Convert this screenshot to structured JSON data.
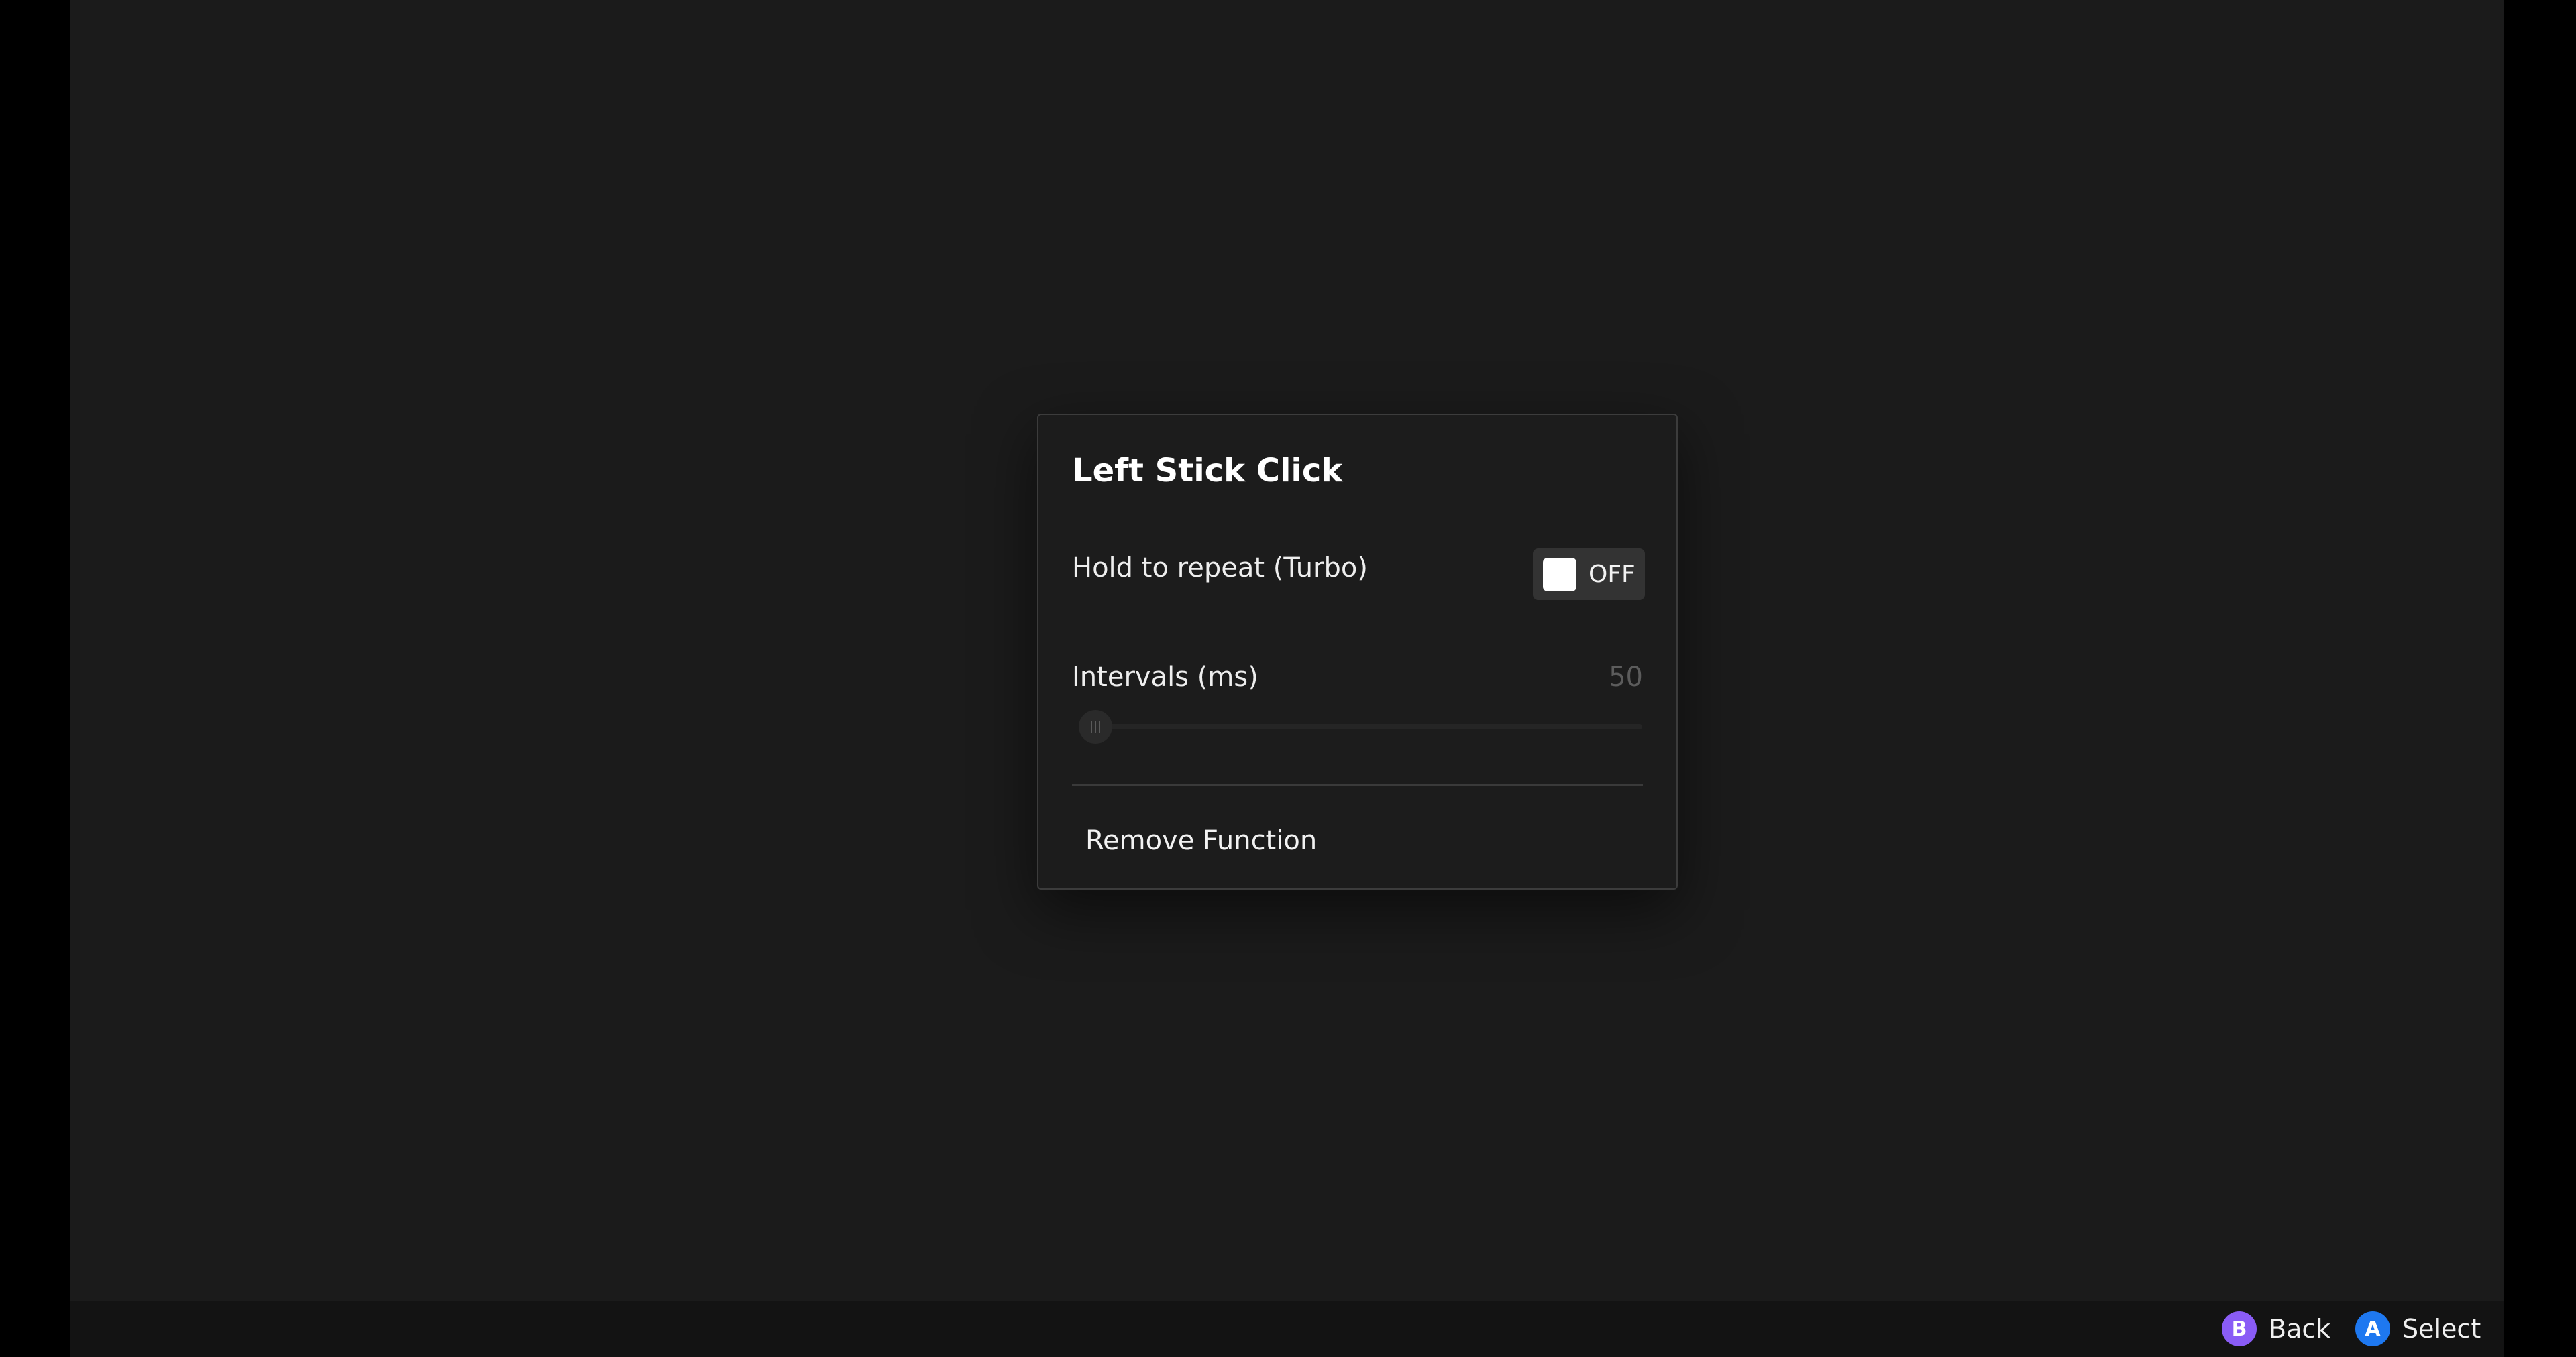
{
  "dialog": {
    "title": "Left Stick Click",
    "turbo": {
      "label": "Hold to repeat (Turbo)",
      "state_label": "OFF",
      "enabled": false
    },
    "intervals": {
      "label": "Intervals (ms)",
      "value": "50",
      "slider_fraction": 0
    },
    "remove_label": "Remove Function"
  },
  "footer": {
    "back": {
      "glyph": "B",
      "label": "Back",
      "color": "#8a5cf6",
      "icon": "b-button-icon"
    },
    "select": {
      "glyph": "A",
      "label": "Select",
      "color": "#1e78f0",
      "icon": "a-button-icon"
    }
  }
}
